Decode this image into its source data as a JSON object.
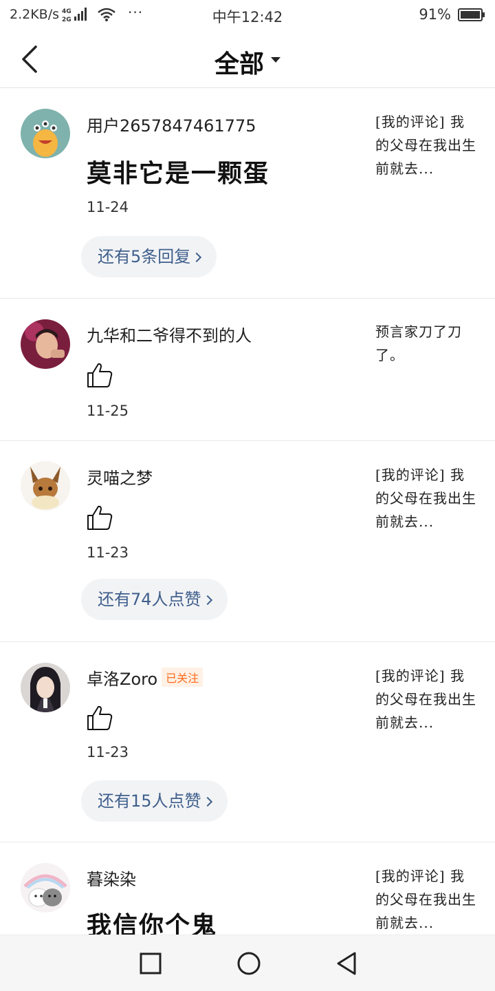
{
  "status_bar": {
    "net_speed": "2.2KB/s",
    "time": "中午12:42",
    "battery": "91%",
    "more": "···",
    "icons": [
      "signal-4g-2g-icon",
      "wifi-icon",
      "battery-icon"
    ]
  },
  "header": {
    "title": "全部",
    "icons": [
      "back-icon",
      "dropdown-caret-icon"
    ]
  },
  "items": [
    {
      "username": "用户2657847461775",
      "content": "莫非它是一颗蛋",
      "date": "11-24",
      "pill": "还有5条回复",
      "ref": "[我的评论] 我的父母在我出生前就去..."
    },
    {
      "username": "九华和二爷得不到的人",
      "date": "11-25",
      "ref": "预言家刀了刀了。"
    },
    {
      "username": "灵喵之梦",
      "date": "11-23",
      "pill": "还有74人点赞",
      "ref": "[我的评论] 我的父母在我出生前就去..."
    },
    {
      "username": "卓洛Zoro",
      "badge": "已关注",
      "date": "11-23",
      "pill": "还有15人点赞",
      "ref": "[我的评论] 我的父母在我出生前就去..."
    },
    {
      "username": "暮染染",
      "content": "我信你个鬼",
      "ref": "[我的评论] 我的父母在我出生前就去..."
    }
  ],
  "nav": {
    "icons": [
      "recent-apps-icon",
      "home-icon",
      "back-nav-icon"
    ]
  },
  "colors": {
    "accent_blue": "#3f5f8c",
    "pill_bg": "#f2f3f5",
    "badge_orange": "#ff6a1a"
  }
}
